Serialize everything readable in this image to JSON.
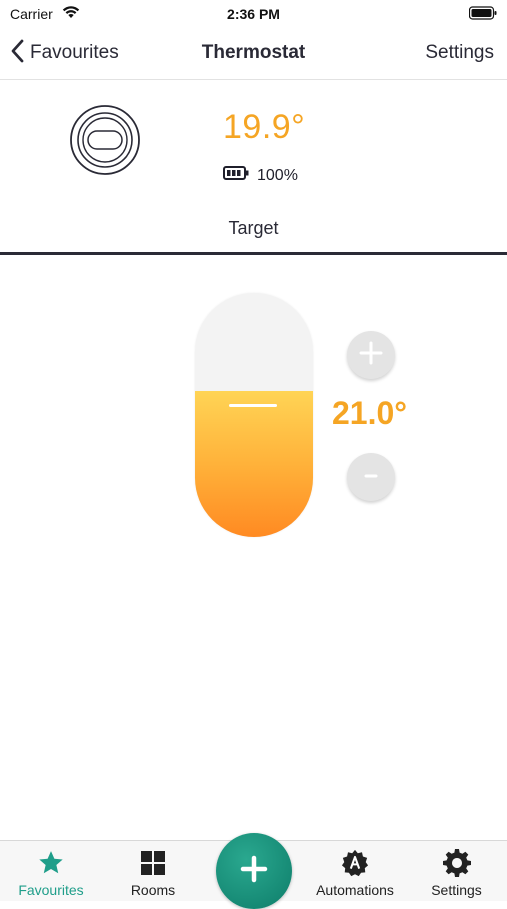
{
  "status_bar": {
    "carrier": "Carrier",
    "time": "2:36 PM"
  },
  "nav": {
    "back_label": "Favourites",
    "title": "Thermostat",
    "right_label": "Settings"
  },
  "device": {
    "icon": "thermostat-device-icon",
    "current_temperature": "19.9°",
    "battery_level": "100%"
  },
  "target": {
    "label": "Target",
    "temperature": "21.0°",
    "fill_fraction": 0.6
  },
  "tabs": [
    {
      "label": "Favourites",
      "icon": "star-icon",
      "active": true
    },
    {
      "label": "Rooms",
      "icon": "grid-icon",
      "active": false
    },
    {
      "label": "Automations",
      "icon": "automations-badge-icon",
      "active": false
    },
    {
      "label": "Settings",
      "icon": "gear-icon",
      "active": false
    }
  ],
  "colors": {
    "accent_orange": "#f5a524",
    "brand_teal": "#1f9e8a",
    "fill_top": "#ffd455",
    "fill_bottom": "#ff8a22"
  }
}
